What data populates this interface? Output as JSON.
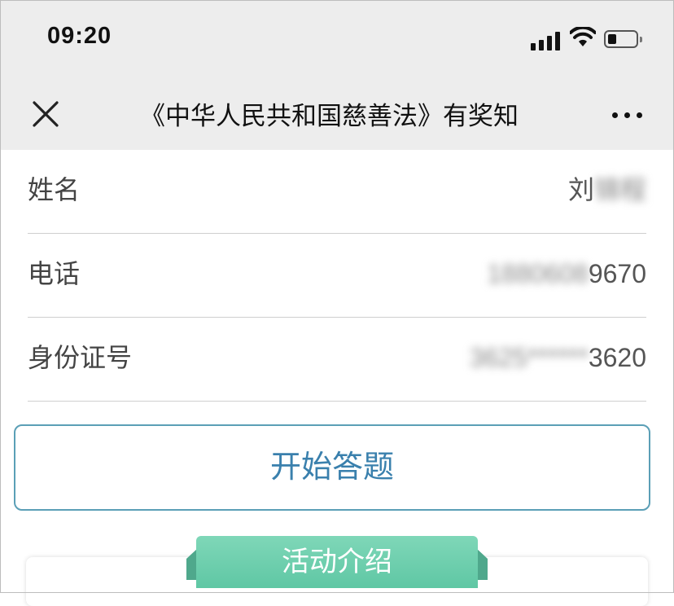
{
  "status_bar": {
    "time": "09:20"
  },
  "nav": {
    "title": "《中华人民共和国慈善法》有奖知"
  },
  "form": {
    "rows": [
      {
        "label": "姓名",
        "value_masked": "锦程",
        "value_visible": "刘"
      },
      {
        "label": "电话",
        "value_masked": "1880608",
        "value_visible": "9670"
      },
      {
        "label": "身份证号",
        "value_masked": "3625******",
        "value_visible": "3620"
      }
    ]
  },
  "start_button": {
    "label": "开始答题"
  },
  "intro": {
    "label": "活动介绍"
  },
  "colors": {
    "accent_blue": "#3a80ad",
    "button_border": "#5b9fb6",
    "ribbon_green": "#6ccfae",
    "nav_bg": "#ededed"
  }
}
